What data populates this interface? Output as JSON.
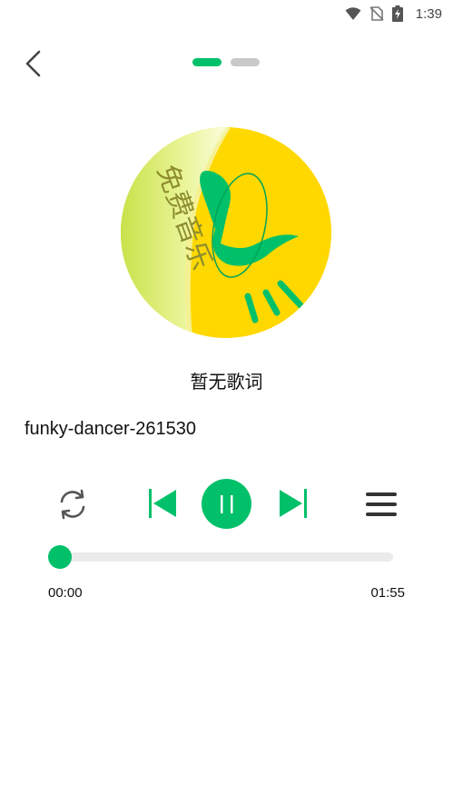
{
  "status_bar": {
    "time": "1:39",
    "icons": [
      "wifi-icon",
      "no-sim-icon",
      "battery-charging-icon"
    ]
  },
  "header": {
    "back_icon": "chevron-left-icon",
    "pages": [
      {
        "active": true
      },
      {
        "active": false
      }
    ]
  },
  "album_art": {
    "logo_text": "免费音乐"
  },
  "lyrics": {
    "text": "暂无歌词"
  },
  "song": {
    "title": "funky-dancer-261530"
  },
  "controls": {
    "repeat_icon": "repeat-icon",
    "prev_icon": "skip-previous-icon",
    "play_pause_icon": "pause-icon",
    "next_icon": "skip-next-icon",
    "playlist_icon": "playlist-menu-icon"
  },
  "progress": {
    "current_time": "00:00",
    "total_time": "01:55",
    "fraction": 0.0
  },
  "colors": {
    "accent": "#00c06a",
    "track": "#ebebeb",
    "album_yellow": "#ffd800"
  }
}
